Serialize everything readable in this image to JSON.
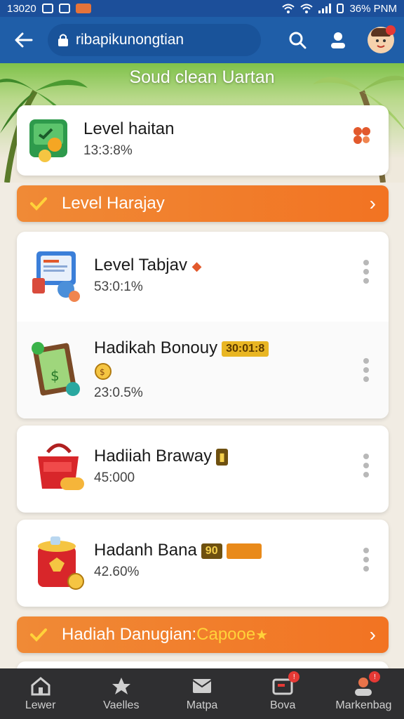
{
  "status_bar": {
    "time": "13020",
    "battery_time": "36% PNM"
  },
  "top_bar": {
    "url": "ribapikunongtian"
  },
  "banner": {
    "title": "Soud clean Uartan"
  },
  "level_card": {
    "title": "Level haitan",
    "value": "13:3:8%"
  },
  "orange_bar_1": {
    "label": "Level Harajay"
  },
  "rewards": [
    {
      "title": "Level Tabjav",
      "value": "53:0:1%",
      "tag": ""
    },
    {
      "title": "Hadikah Bonouy",
      "value": "23:0.5%",
      "tag": "30:01:8"
    },
    {
      "title": "Hadiiah Braway",
      "value": "45:000",
      "tag": ""
    },
    {
      "title": "Hadanh Bana",
      "value": "42.60%",
      "tag": "90"
    }
  ],
  "orange_bar_2": {
    "label": "Hadiah Danugian: ",
    "highlight": "Capooe"
  },
  "bottom_nav": [
    {
      "label": "Lewer",
      "icon": "home-icon"
    },
    {
      "label": "Vaelles",
      "icon": "star-icon"
    },
    {
      "label": "Matpa",
      "icon": "mail-icon"
    },
    {
      "label": "Bova",
      "icon": "wallet-icon"
    },
    {
      "label": "Markenbag",
      "icon": "profile-icon"
    }
  ],
  "colors": {
    "header": "#1f5ea8",
    "accent": "#f27322",
    "highlight": "#ffd23a"
  }
}
